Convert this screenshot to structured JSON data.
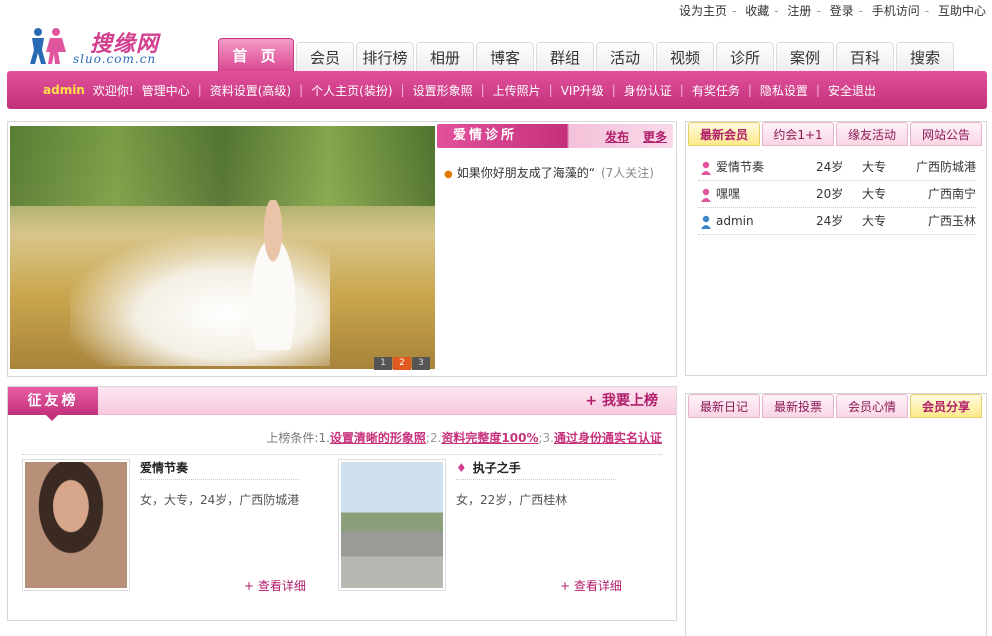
{
  "toplinks": [
    "设为主页",
    "收藏",
    "注册",
    "登录",
    "手机访问",
    "互助中心"
  ],
  "logo": {
    "brand": "搜缘网",
    "domain": "sluo.com.cn"
  },
  "mainnav": [
    "首 页",
    "会员",
    "排行榜",
    "相册",
    "博客",
    "群组",
    "活动",
    "视频",
    "诊所",
    "案例",
    "百科",
    "搜索"
  ],
  "subbar": {
    "user": "admin",
    "welcome": "欢迎你!",
    "items": [
      "管理中心",
      "资料设置(高级)",
      "个人主页(装扮)",
      "设置形象照",
      "上传照片",
      "VIP升级",
      "身份认证",
      "有奖任务",
      "隐私设置",
      "安全退出"
    ]
  },
  "featured": {
    "pager": [
      "1",
      "2",
      "3"
    ],
    "clinic_title": "爱情诊所",
    "publish": "发布",
    "more": "更多",
    "item_text": "如果你好朋友成了海藻的“",
    "item_count": "(7人关注)"
  },
  "ranking": {
    "title": "征友榜",
    "join": "+ 我要上榜",
    "cond_label": "上榜条件:",
    "cond_n1": "1.",
    "cond1": "设置清晰的形象照",
    "cond_n2": ";2.",
    "cond2": "资料完整度100%",
    "cond_n3": ";3.",
    "cond3": "通过身份通实名认证",
    "cards": [
      {
        "name": "爱情节奏",
        "info": "女，大专，24岁，广西防城港",
        "more": "+ 查看详细"
      },
      {
        "name": "执子之手",
        "info": "女，22岁，广西桂林",
        "more": "+ 查看详细"
      }
    ]
  },
  "members": {
    "tabs": [
      "最新会员",
      "约会1+1",
      "缘友活动",
      "网站公告"
    ],
    "rows": [
      {
        "name": "爱情节奏",
        "age": "24岁",
        "edu": "大专",
        "loc": "广西防城港",
        "gender": "female"
      },
      {
        "name": "嘿嘿",
        "age": "20岁",
        "edu": "大专",
        "loc": "广西南宁",
        "gender": "female"
      },
      {
        "name": "admin",
        "age": "24岁",
        "edu": "大专",
        "loc": "广西玉林",
        "gender": "male"
      }
    ]
  },
  "diary": {
    "tabs": [
      "最新日记",
      "最新投票",
      "会员心情",
      "会员分享"
    ]
  },
  "colors": {
    "accent": "#d23f8f",
    "accent_dark": "#c2307a",
    "gold_tab": "#fde98a"
  }
}
